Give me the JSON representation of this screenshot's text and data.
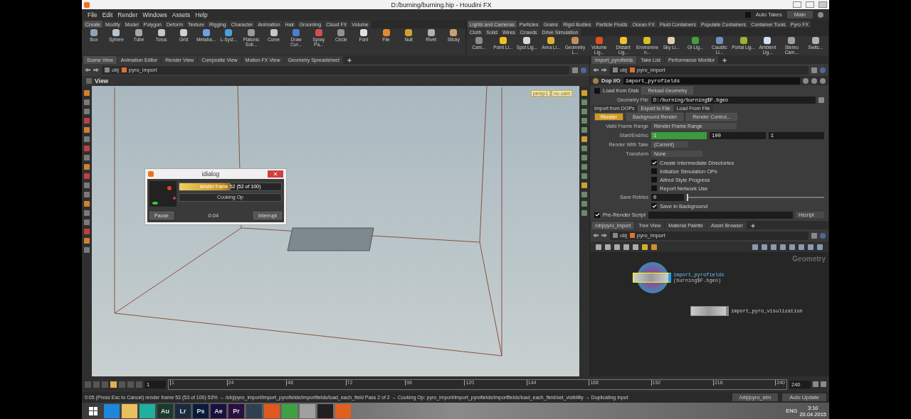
{
  "window": {
    "title": "D:/burning/burning.hip - Houdini FX"
  },
  "menu": [
    "File",
    "Edit",
    "Render",
    "Windows",
    "Assets",
    "Help"
  ],
  "top_right": {
    "auto_takes": {
      "label": "Auto Takes",
      "checked": false
    },
    "take": "Main"
  },
  "shelves": [
    {
      "tabs": [
        {
          "label": "Create",
          "selected": true
        },
        {
          "label": "Modify",
          "selected": false
        },
        {
          "label": "Model",
          "selected": false
        },
        {
          "label": "Polygon",
          "selected": false
        },
        {
          "label": "Deform",
          "selected": false
        },
        {
          "label": "Texture",
          "selected": false
        },
        {
          "label": "Rigging",
          "selected": false
        },
        {
          "label": "Character",
          "selected": false
        },
        {
          "label": "Animation",
          "selected": false
        },
        {
          "label": "Hair",
          "selected": false
        },
        {
          "label": "Grooming",
          "selected": false
        },
        {
          "label": "Cloud FX",
          "selected": false
        },
        {
          "label": "Volume",
          "selected": false
        }
      ],
      "tools": [
        {
          "label": "Box",
          "color": "#8fa3b5"
        },
        {
          "label": "Sphere",
          "color": "#b8c4d0"
        },
        {
          "label": "Tube",
          "color": "#a0a8b0"
        },
        {
          "label": "Torus",
          "color": "#c0c8d0"
        },
        {
          "label": "Grid",
          "color": "#d0d0d0"
        },
        {
          "label": "Metaba...",
          "color": "#6f9fe0"
        },
        {
          "label": "L-Syst...",
          "color": "#4aa3d8"
        },
        {
          "label": "Platonic Soli...",
          "color": "#9a9a9a"
        },
        {
          "label": "Curve",
          "color": "#c8c8c8"
        },
        {
          "label": "Draw Cur...",
          "color": "#4a7fd0"
        },
        {
          "label": "Spray Pa...",
          "color": "#d05050"
        },
        {
          "label": "Circle",
          "color": "#909090"
        },
        {
          "label": "Font",
          "color": "#e0e0e0"
        },
        {
          "label": "File",
          "color": "#e08a30"
        },
        {
          "label": "Null",
          "color": "#d0a030"
        },
        {
          "label": "Rivet",
          "color": "#b0b0b0"
        },
        {
          "label": "Sticky",
          "color": "#c8a070"
        }
      ]
    },
    {
      "tabs": [
        {
          "label": "Lights and Cameras",
          "selected": true
        },
        {
          "label": "Particles",
          "selected": false
        },
        {
          "label": "Grains",
          "selected": false
        },
        {
          "label": "Rigid Bodies",
          "selected": false
        },
        {
          "label": "Particle Fluids",
          "selected": false
        },
        {
          "label": "Ocean FX",
          "selected": false
        },
        {
          "label": "Fluid Containers",
          "selected": false
        },
        {
          "label": "Populate Containers",
          "selected": false
        },
        {
          "label": "Container Tools",
          "selected": false
        },
        {
          "label": "Pyro FX",
          "selected": false
        },
        {
          "label": "Cloth",
          "selected": false
        },
        {
          "label": "Solid",
          "selected": false
        },
        {
          "label": "Wires",
          "selected": false
        },
        {
          "label": "Crowds",
          "selected": false
        },
        {
          "label": "Drive Simulation",
          "selected": false
        }
      ],
      "tools": [
        {
          "label": "Cam...",
          "color": "#8a8a8a"
        },
        {
          "label": "Point Li...",
          "color": "#f0c020"
        },
        {
          "label": "Spot Lig...",
          "color": "#d8d8d0"
        },
        {
          "label": "Area Li...",
          "color": "#e0b030"
        },
        {
          "label": "Geometry L...",
          "color": "#c09060"
        },
        {
          "label": "Volume Lig...",
          "color": "#e05020"
        },
        {
          "label": "Distant Lig...",
          "color": "#f0c030"
        },
        {
          "label": "Environmen...",
          "color": "#d8c020"
        },
        {
          "label": "Sky Li...",
          "color": "#e0d0b0"
        },
        {
          "label": "GI Lig...",
          "color": "#40a040"
        },
        {
          "label": "Caustic Li...",
          "color": "#7090c0"
        },
        {
          "label": "Portal Lig...",
          "color": "#a0b030"
        },
        {
          "label": "Ambient Lig...",
          "color": "#d0e0f0"
        },
        {
          "label": "Stereo Cam...",
          "color": "#a0a0a0"
        },
        {
          "label": "Switc...",
          "color": "#b0b0b0"
        }
      ]
    }
  ],
  "left_pane": {
    "tabs": [
      {
        "label": "Scene View",
        "selected": true
      },
      {
        "label": "Animation Editor",
        "selected": false
      },
      {
        "label": "Render View",
        "selected": false
      },
      {
        "label": "Composite View",
        "selected": false
      },
      {
        "label": "Motion FX View",
        "selected": false
      },
      {
        "label": "Geometry Spreadsheet",
        "selected": false
      }
    ],
    "path": [
      "obj",
      "pyro_import"
    ],
    "title": "View",
    "camera": [
      "persp1",
      "no cam"
    ]
  },
  "dialog": {
    "title": "idialog",
    "progress": {
      "label": "render frame 52 (52 of 100)",
      "level": 0.5
    },
    "status": "Cooking Op",
    "elapsed": "0:04",
    "buttons": [
      "Pause",
      "Interrupt"
    ]
  },
  "params": {
    "tabs": [
      {
        "label": "import_pyrofields",
        "selected": true
      },
      {
        "label": "Take List",
        "selected": false
      },
      {
        "label": "Performance Monitor",
        "selected": false
      }
    ],
    "path": [
      "obj",
      "pyro_import"
    ],
    "node_type": "Dop I/O",
    "node_name": "import_pyrofields",
    "load_from_disk": {
      "label": "Load from Disk",
      "checked": false
    },
    "reload": "Reload Geometry",
    "geometry_file": {
      "label": "Geometry File",
      "value": "D:/burning/burning$F.bgeo"
    },
    "sub_tabs": [
      {
        "label": "Import from DOPs",
        "selected": false
      },
      {
        "label": "Export to File",
        "selected": true
      },
      {
        "label": "Load From File",
        "selected": false
      }
    ],
    "render_buttons": [
      {
        "label": "Render",
        "kind": "primary"
      },
      {
        "label": "Background Render",
        "kind": "normal"
      },
      {
        "label": "Render Control...",
        "kind": "normal"
      }
    ],
    "valid_frame_range": {
      "label": "Valid Frame Range",
      "value": "Render Frame Range"
    },
    "start_end_inc": {
      "label": "Start/End/Inc",
      "values": [
        "1",
        "100",
        "1"
      ],
      "keyed": true
    },
    "render_with_take": {
      "label": "Render With Take",
      "value": "(Current)"
    },
    "transform": {
      "label": "Transform",
      "value": "None"
    },
    "toggles": [
      {
        "label": "Create Intermediate Directories",
        "checked": true
      },
      {
        "label": "Initialize Simulation OPs",
        "checked": false
      },
      {
        "label": "Alfred Style Progress",
        "checked": false
      },
      {
        "label": "Report Network Use",
        "checked": false
      }
    ],
    "save_retries": {
      "label": "Save Retries",
      "value": "0",
      "level": 0
    },
    "save_in_background": {
      "label": "Save in Background",
      "checked": true
    },
    "pre_render": {
      "label": "Pre-Render Script",
      "checked": true,
      "language": "Hscript"
    }
  },
  "network": {
    "tabs": [
      {
        "label": "/obj/pyro_import",
        "selected": true
      },
      {
        "label": "Tree View",
        "selected": false
      },
      {
        "label": "Material Palette",
        "selected": false
      },
      {
        "label": "Asset Browser",
        "selected": false
      }
    ],
    "path": [
      "obj",
      "pyro_import"
    ],
    "context": "Geometry",
    "nodes": [
      {
        "name": "import_pyrofields",
        "detail": "(burning$F.bgeo)",
        "selected": true
      },
      {
        "name": "import_pyro_visulization",
        "selected": false
      }
    ]
  },
  "timeline": {
    "frame": "1",
    "ticks": [
      "1",
      "24",
      "48",
      "72",
      "96",
      "120",
      "144",
      "168",
      "192",
      "216",
      "240"
    ],
    "end": "240"
  },
  "status_bar": {
    "message": "0:05 (Press Esc to Cancel) render frame 53 (53 of 100) 53% → /obj/pyro_import/import_pyrofields/importfields/load_each_field  Pass 2 of 2 → Cooking Op: pyro_import/import_pyrofields/importfields/load_each_field/set_visibility → Duplicating input",
    "path": "/obj/pyro_sim",
    "update": "Auto Update"
  },
  "taskbar": {
    "apps": [
      {
        "color": "#1e88d8"
      },
      {
        "color": "#e8c060"
      },
      {
        "color": "#20b0a0"
      },
      {
        "label": "Au",
        "color": "#1a3a30"
      },
      {
        "label": "Lr",
        "color": "#1a2a40"
      },
      {
        "label": "Ps",
        "color": "#0a1a3a"
      },
      {
        "label": "Ae",
        "color": "#1a1040"
      },
      {
        "label": "Pr",
        "color": "#2a1040"
      },
      {
        "color": "#304050"
      },
      {
        "color": "#e05a20"
      },
      {
        "color": "#40a040"
      },
      {
        "color": "#a0a0a0"
      },
      {
        "color": "#202020"
      },
      {
        "color": "#e06020"
      }
    ],
    "language": "ENG",
    "time": "3:10",
    "date": "20.04.2015"
  }
}
